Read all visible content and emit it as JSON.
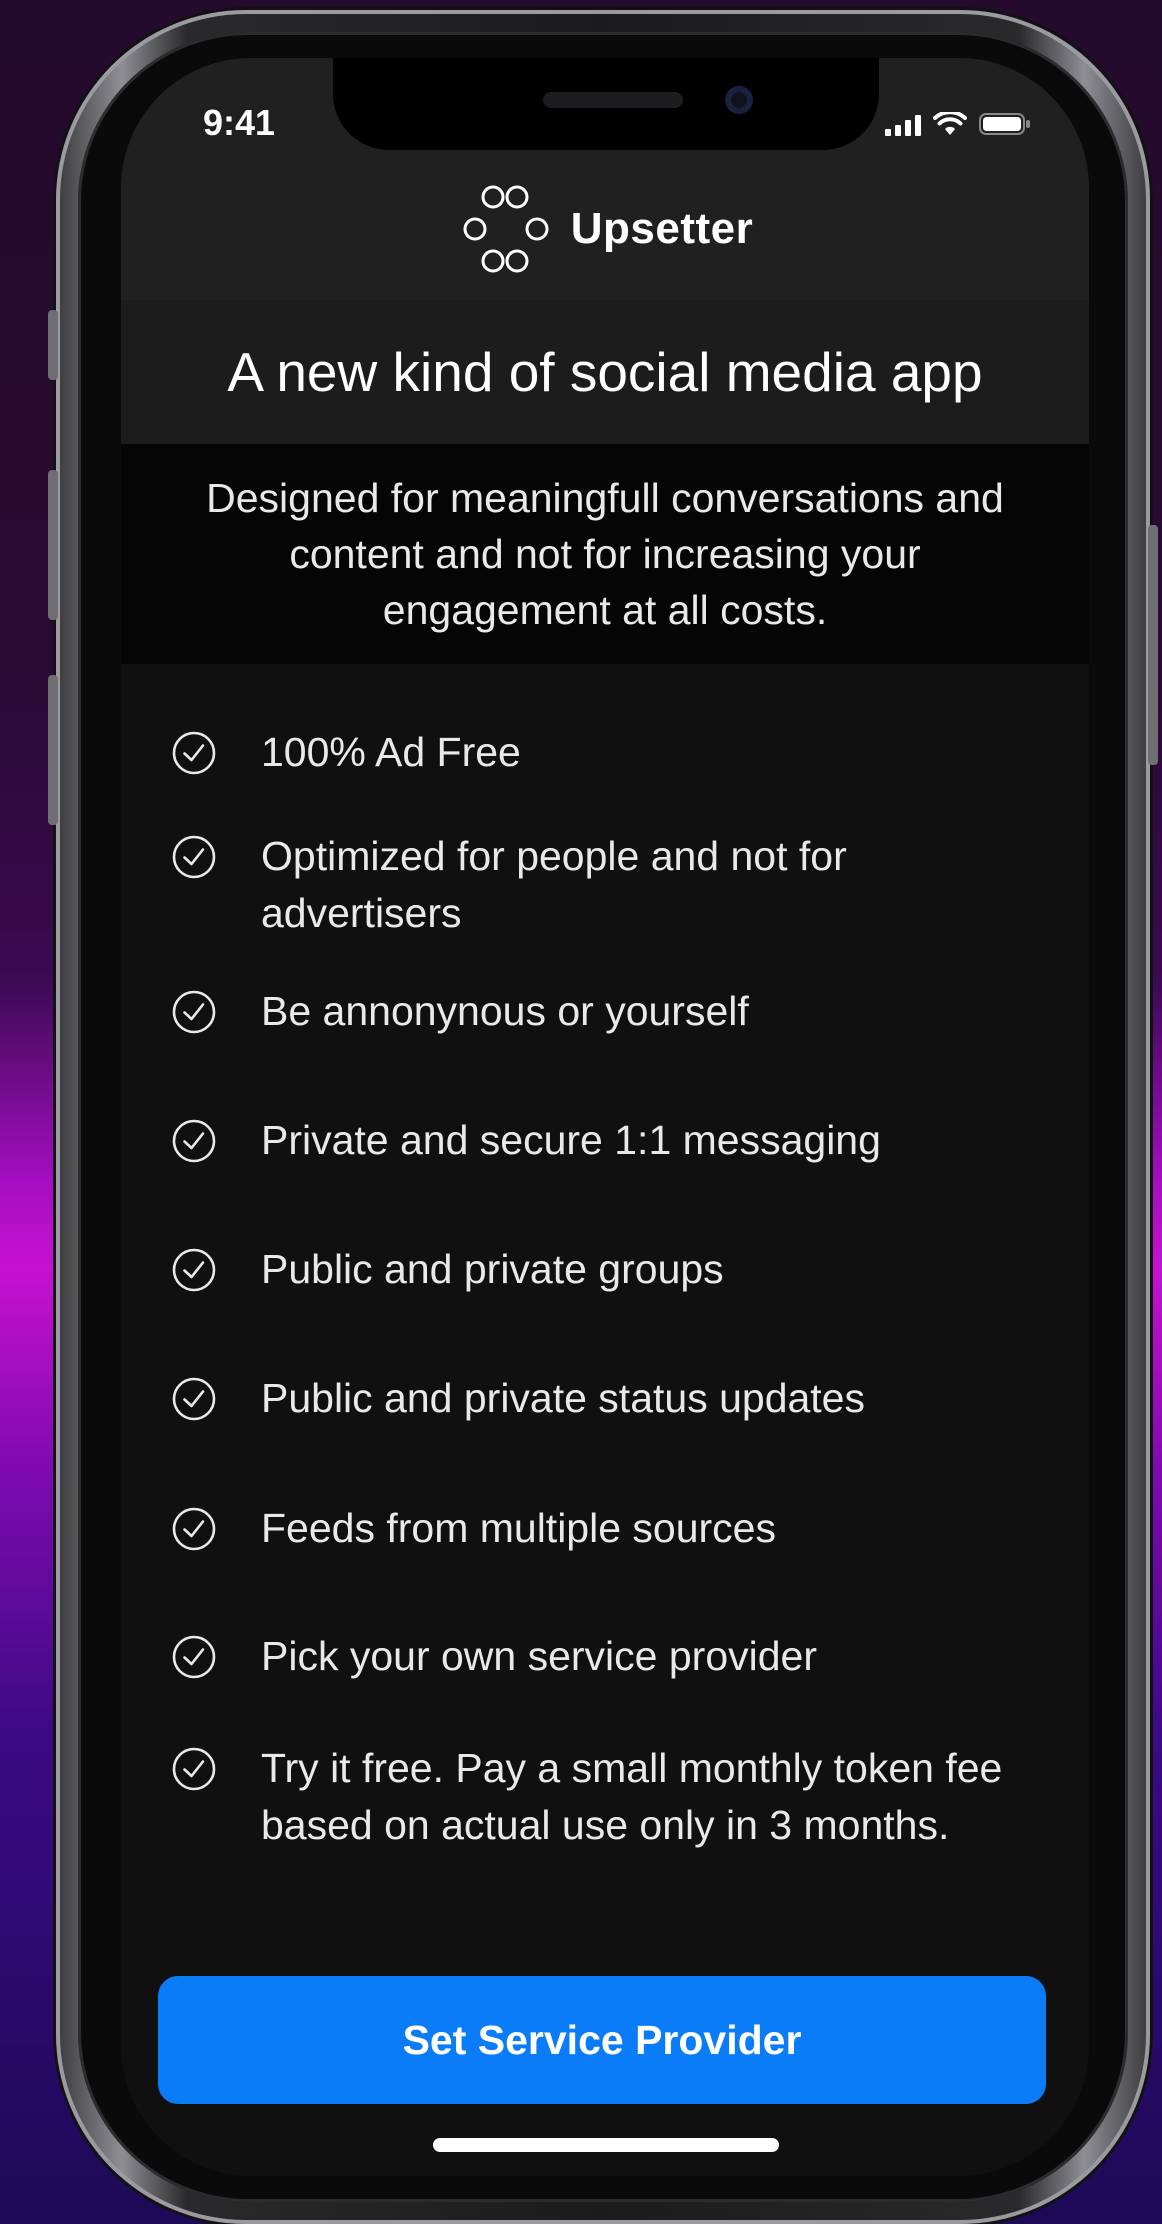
{
  "status_bar": {
    "time": "9:41",
    "icons": [
      "cellular-signal-icon",
      "wifi-icon",
      "battery-icon"
    ]
  },
  "header": {
    "logo_icon": "upsetter-logo-icon",
    "app_name": "Upsetter"
  },
  "hero": {
    "headline": "A new kind of social media app",
    "subheadline": "Designed for meaningfull conversations and content and not for increasing your engagement at all costs."
  },
  "features": [
    {
      "icon": "check-circle-icon",
      "text": "100% Ad Free"
    },
    {
      "icon": "check-circle-icon",
      "text": "Optimized for people and not for advertisers"
    },
    {
      "icon": "check-circle-icon",
      "text": "Be annonynous or yourself"
    },
    {
      "icon": "check-circle-icon",
      "text": "Private and secure 1:1 messaging"
    },
    {
      "icon": "check-circle-icon",
      "text": "Public and private groups"
    },
    {
      "icon": "check-circle-icon",
      "text": "Public and private status updates"
    },
    {
      "icon": "check-circle-icon",
      "text": "Feeds from multiple sources"
    },
    {
      "icon": "check-circle-icon",
      "text": "Pick your own service provider"
    },
    {
      "icon": "check-circle-icon",
      "text": "Try it free. Pay a small monthly token fee based on actual use only in 3 months."
    }
  ],
  "cta": {
    "label": "Set Service Provider"
  },
  "colors": {
    "accent": "#0A7CF8",
    "screen_background": "#101011",
    "header_background": "#202021",
    "text": "#E9E9EA"
  }
}
